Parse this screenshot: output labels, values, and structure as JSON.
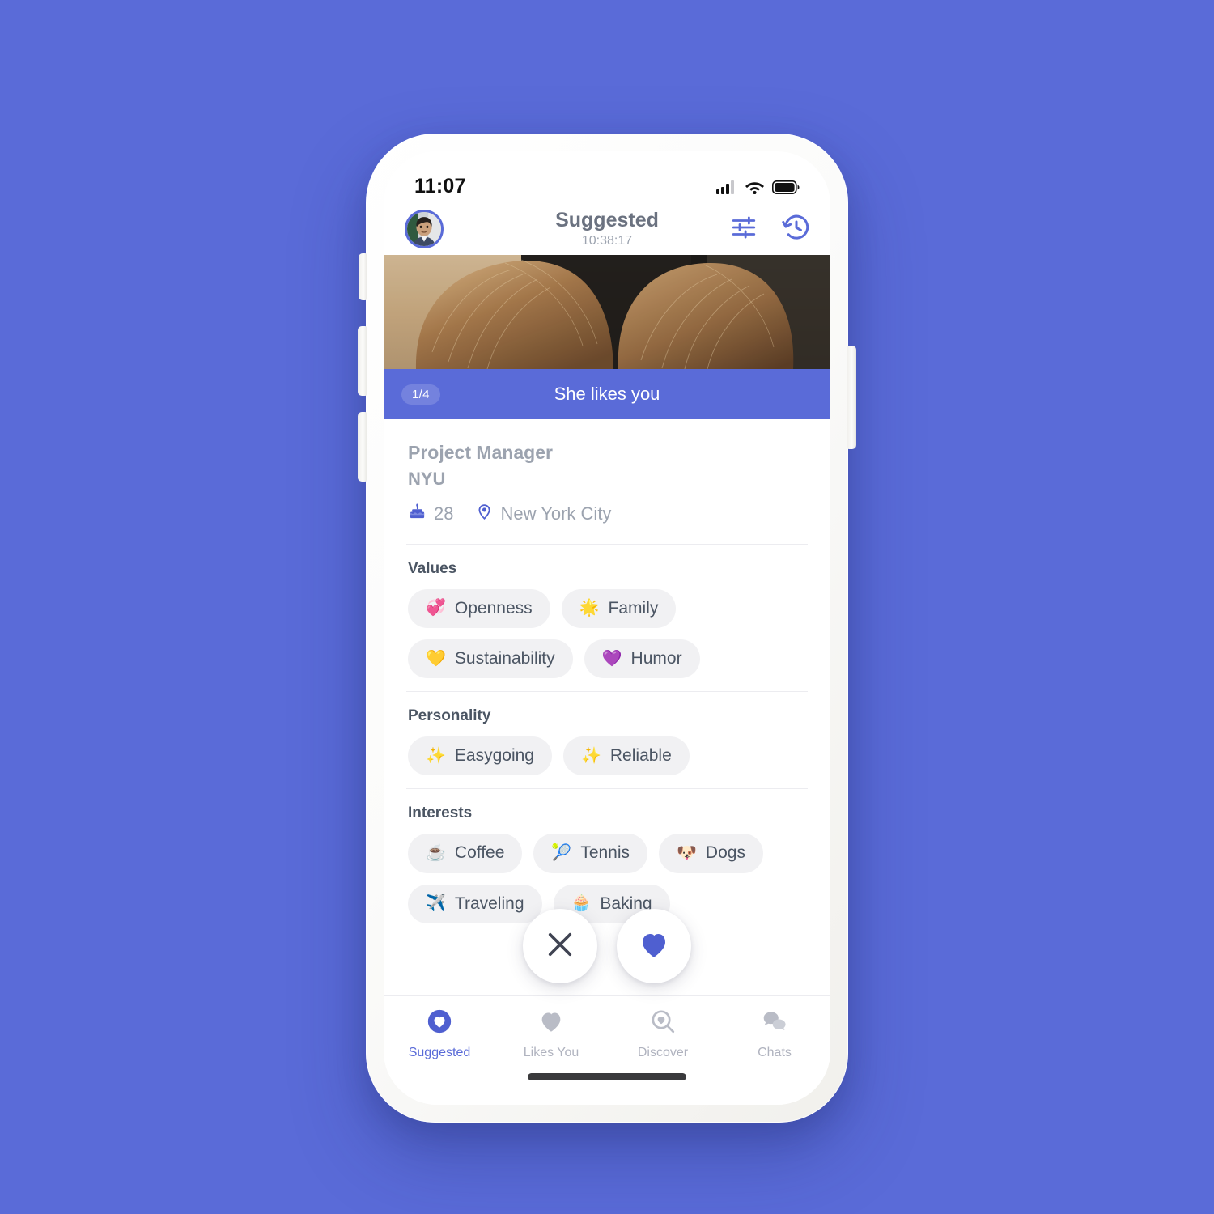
{
  "theme": {
    "background": "#5a6bd8",
    "accent": "#5a6bd8",
    "chip_bg": "#f1f1f3",
    "muted_text": "#9ca3af"
  },
  "status_bar": {
    "time": "11:07",
    "icons": [
      "cellular-signal-icon",
      "wifi-icon",
      "battery-icon"
    ]
  },
  "header": {
    "avatar_name": "profile-avatar",
    "title": "Suggested",
    "subtitle": "10:38:17",
    "actions": [
      {
        "name": "filter-sliders-icon",
        "label": "Filters"
      },
      {
        "name": "history-clock-icon",
        "label": "History"
      }
    ]
  },
  "hero": {
    "photo_alt": "Two people with long hair outdoors",
    "counter": "1/4",
    "banner_text": "She likes you"
  },
  "profile": {
    "job_title": "Project Manager",
    "school": "NYU",
    "age": "28",
    "location": "New York City",
    "age_icon": "birthday-cake-icon",
    "location_icon": "location-pin-icon"
  },
  "sections": [
    {
      "id": "values",
      "title": "Values",
      "chips": [
        {
          "emoji": "💞",
          "label": "Openness"
        },
        {
          "emoji": "🌟",
          "label": "Family"
        },
        {
          "emoji": "💛",
          "label": "Sustainability"
        },
        {
          "emoji": "💜",
          "label": "Humor"
        }
      ]
    },
    {
      "id": "personality",
      "title": "Personality",
      "chips": [
        {
          "emoji": "✨",
          "label": "Easygoing"
        },
        {
          "emoji": "✨",
          "label": "Reliable"
        }
      ]
    },
    {
      "id": "interests",
      "title": "Interests",
      "chips": [
        {
          "emoji": "☕",
          "label": "Coffee"
        },
        {
          "emoji": "🎾",
          "label": "Tennis"
        },
        {
          "emoji": "🐶",
          "label": "Dogs"
        },
        {
          "emoji": "✈️",
          "label": "Traveling"
        },
        {
          "emoji": "🧁",
          "label": "Baking"
        }
      ]
    }
  ],
  "actions": {
    "pass": {
      "name": "pass-button",
      "icon": "close-x-icon"
    },
    "like": {
      "name": "like-button",
      "icon": "heart-icon"
    }
  },
  "bottom_nav": [
    {
      "id": "suggested",
      "label": "Suggested",
      "icon": "heart-circle-icon",
      "active": true
    },
    {
      "id": "likes-you",
      "label": "Likes You",
      "icon": "heart-icon",
      "active": false
    },
    {
      "id": "discover",
      "label": "Discover",
      "icon": "search-heart-icon",
      "active": false
    },
    {
      "id": "chats",
      "label": "Chats",
      "icon": "chat-bubbles-icon",
      "active": false
    }
  ]
}
